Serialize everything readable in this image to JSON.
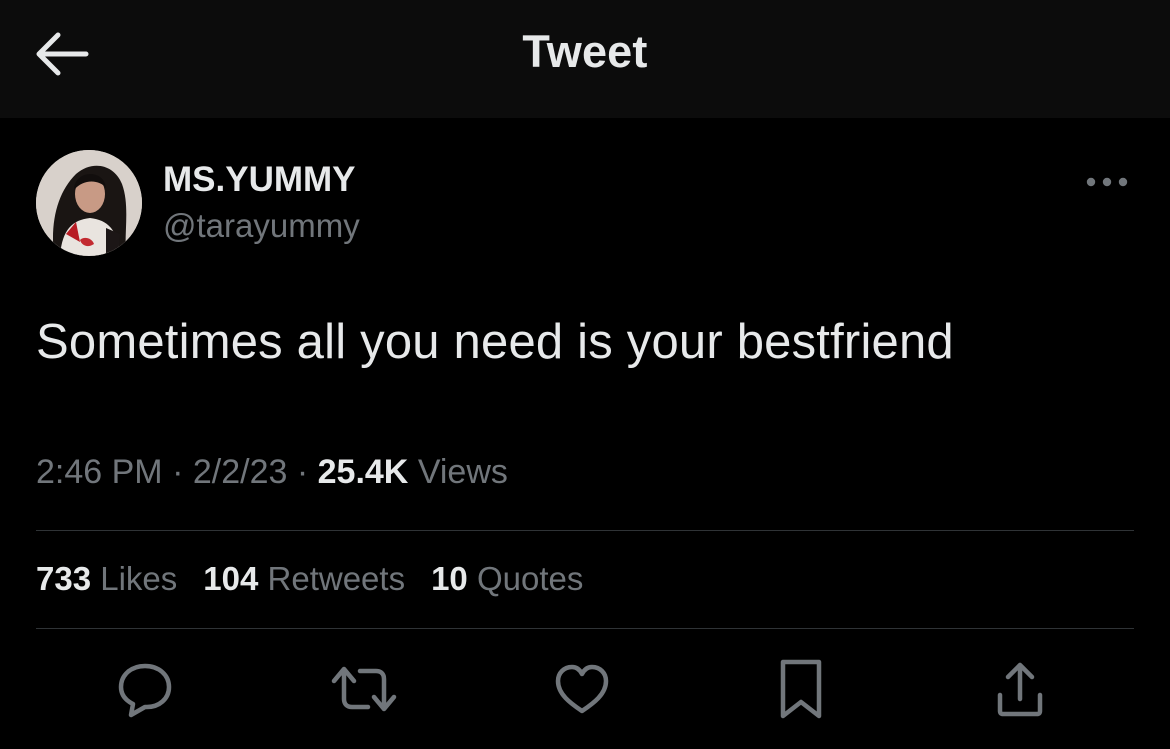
{
  "header": {
    "title": "Tweet",
    "back_icon": "arrow-left-icon"
  },
  "author": {
    "display_name": "MS.YUMMY",
    "handle": "@tarayummy",
    "avatar": "profile-photo"
  },
  "tweet": {
    "text": "Sometimes all you need is your bestfriend"
  },
  "meta": {
    "time": "2:46 PM",
    "separator": "·",
    "date": "2/2/23",
    "views_count": "25.4K",
    "views_label": "Views"
  },
  "stats": {
    "likes_count": "733",
    "likes_label": "Likes",
    "retweets_count": "104",
    "retweets_label": "Retweets",
    "quotes_count": "10",
    "quotes_label": "Quotes"
  },
  "actions": [
    "reply-icon",
    "retweet-icon",
    "like-icon",
    "bookmark-icon",
    "share-icon"
  ],
  "colors": {
    "background": "#000000",
    "header_background": "#0c0c0c",
    "primary_text": "#e7e9ea",
    "secondary_text": "#71767b",
    "divider": "#2f3336"
  }
}
